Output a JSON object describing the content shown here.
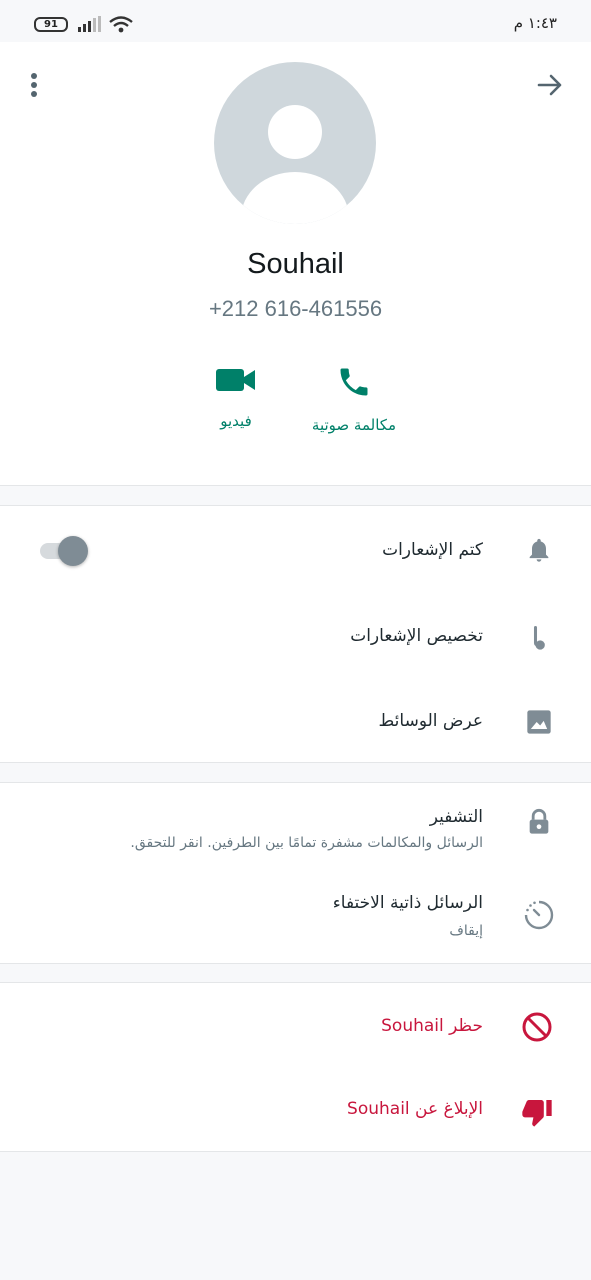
{
  "status_bar": {
    "time": "١:٤٣ م",
    "battery": "91"
  },
  "profile": {
    "name": "Souhail",
    "phone": "+212 616-461556"
  },
  "actions": {
    "video_label": "فيديو",
    "voice_label": "مكالمة صوتية"
  },
  "notifications": {
    "mute_label": "كتم الإشعارات",
    "mute_enabled": false,
    "custom_label": "تخصيص الإشعارات",
    "media_label": "عرض الوسائط"
  },
  "security": {
    "encryption_title": "التشفير",
    "encryption_desc": "الرسائل والمكالمات مشفرة تمامًا بين الطرفين. انقر للتحقق.",
    "disappearing_title": "الرسائل ذاتية الاختفاء",
    "disappearing_value": "إيقاف"
  },
  "danger": {
    "block_label": "حظر Souhail",
    "report_label": "الإبلاغ عن Souhail"
  },
  "colors": {
    "accent": "#008069",
    "danger": "#c8163d",
    "icon_gray": "#7f8c95"
  }
}
